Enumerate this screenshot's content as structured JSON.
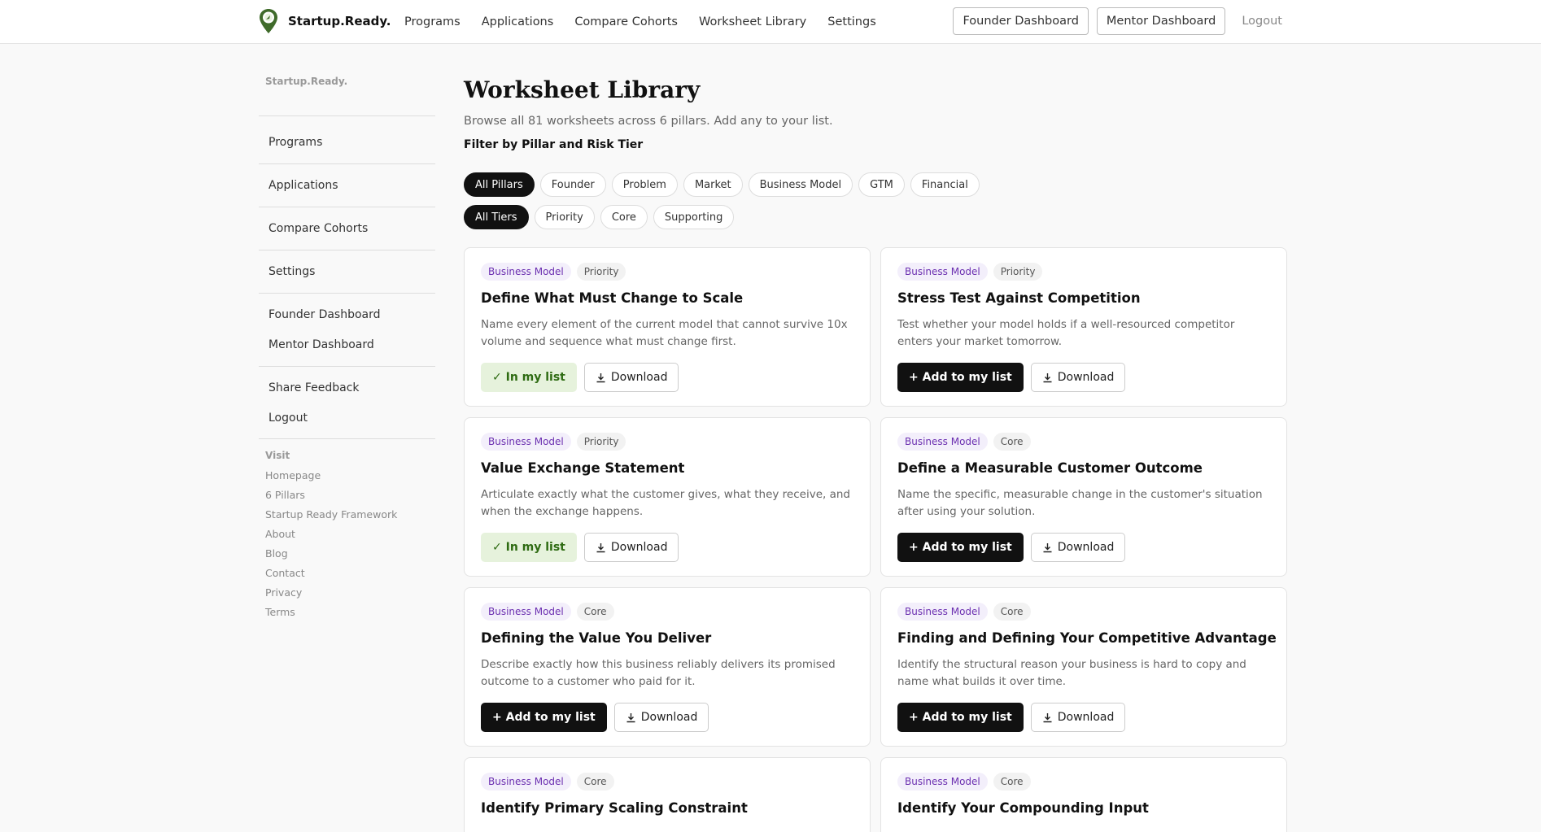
{
  "brand": {
    "name": "Startup.Ready."
  },
  "nav": {
    "links": [
      "Programs",
      "Applications",
      "Compare Cohorts",
      "Worksheet Library",
      "Settings"
    ],
    "founder_dashboard": "Founder Dashboard",
    "mentor_dashboard": "Mentor Dashboard",
    "logout": "Logout"
  },
  "sidebar": {
    "brand": "Startup.Ready.",
    "group1": [
      "Programs",
      "Applications",
      "Compare Cohorts",
      "Settings"
    ],
    "group2": [
      "Founder Dashboard",
      "Mentor Dashboard"
    ],
    "group3": [
      "Share Feedback",
      "Logout"
    ],
    "visit_label": "Visit",
    "visit_links": [
      "Homepage",
      "6 Pillars",
      "Startup Ready Framework",
      "About",
      "Blog",
      "Contact",
      "Privacy",
      "Terms"
    ]
  },
  "main": {
    "title": "Worksheet Library",
    "subtitle": "Browse all 81 worksheets across 6 pillars. Add any to your list.",
    "filter_label": "Filter by Pillar and Risk Tier",
    "pillar_filters": [
      "All Pillars",
      "Founder",
      "Problem",
      "Market",
      "Business Model",
      "GTM",
      "Financial"
    ],
    "tier_filters": [
      "All Tiers",
      "Priority",
      "Core",
      "Supporting"
    ],
    "active_pillar": "All Pillars",
    "active_tier": "All Tiers"
  },
  "actions": {
    "in_list": "✓ In my list",
    "add": "+ Add to my list",
    "download": "Download"
  },
  "cards": [
    {
      "pillar": "Business Model",
      "tier": "Priority",
      "title": "Define What Must Change to Scale",
      "desc": "Name every element of the current model that cannot survive 10x volume and sequence what must change first.",
      "in_list": true
    },
    {
      "pillar": "Business Model",
      "tier": "Priority",
      "title": "Stress Test Against Competition",
      "desc": "Test whether your model holds if a well-resourced competitor enters your market tomorrow.",
      "in_list": false
    },
    {
      "pillar": "Business Model",
      "tier": "Priority",
      "title": "Value Exchange Statement",
      "desc": "Articulate exactly what the customer gives, what they receive, and when the exchange happens.",
      "in_list": true
    },
    {
      "pillar": "Business Model",
      "tier": "Core",
      "title": "Define a Measurable Customer Outcome",
      "desc": "Name the specific, measurable change in the customer's situation after using your solution.",
      "in_list": false
    },
    {
      "pillar": "Business Model",
      "tier": "Core",
      "title": "Defining the Value You Deliver",
      "desc": "Describe exactly how this business reliably delivers its promised outcome to a customer who paid for it.",
      "in_list": false
    },
    {
      "pillar": "Business Model",
      "tier": "Core",
      "title": "Finding and Defining Your Competitive Advantage",
      "desc": "Identify the structural reason your business is hard to copy and name what builds it over time.",
      "in_list": false
    },
    {
      "pillar": "Business Model",
      "tier": "Core",
      "title": "Identify Primary Scaling Constraint",
      "desc": "",
      "in_list": false
    },
    {
      "pillar": "Business Model",
      "tier": "Core",
      "title": "Identify Your Compounding Input",
      "desc": "",
      "in_list": false
    }
  ]
}
